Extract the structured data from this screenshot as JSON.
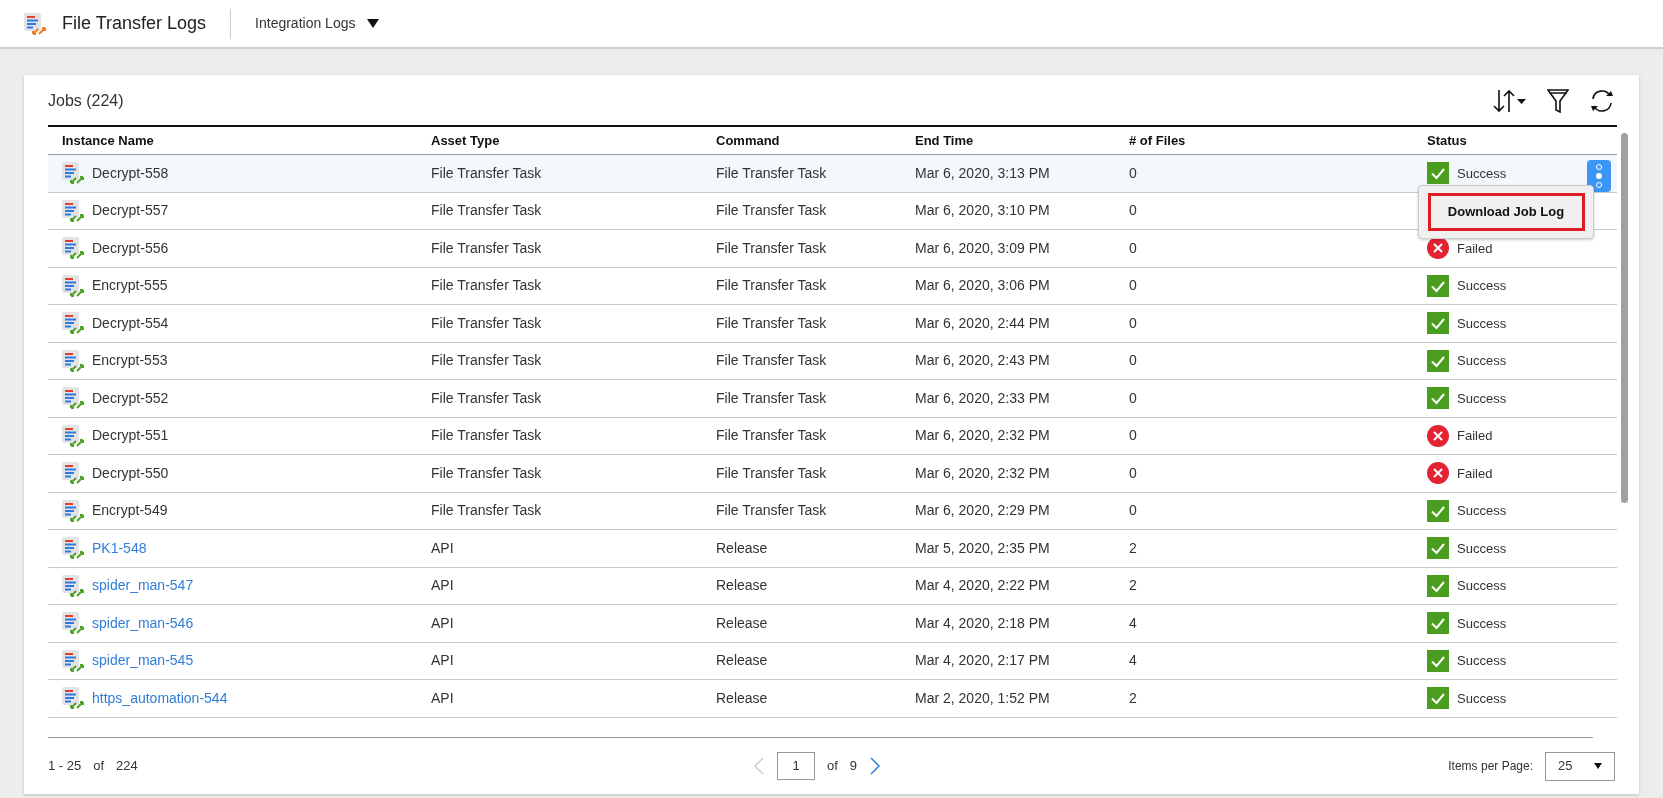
{
  "header": {
    "title": "File Transfer Logs",
    "menu": "Integration Logs"
  },
  "jobs": {
    "title": "Jobs (224)",
    "columns": [
      "Instance Name",
      "Asset Type",
      "Command",
      "End Time",
      "# of Files",
      "Status"
    ],
    "rows": [
      {
        "name": "Decrypt-558",
        "linked": false,
        "selected": true,
        "asset": "File Transfer Task",
        "command": "File Transfer Task",
        "end": "Mar 6, 2020, 3:13 PM",
        "files": "0",
        "status": {
          "kind": "success",
          "label": "Success"
        }
      },
      {
        "name": "Decrypt-557",
        "linked": false,
        "selected": false,
        "asset": "File Transfer Task",
        "command": "File Transfer Task",
        "end": "Mar 6, 2020, 3:10 PM",
        "files": "0"
      },
      {
        "name": "Decrypt-556",
        "linked": false,
        "selected": false,
        "asset": "File Transfer Task",
        "command": "File Transfer Task",
        "end": "Mar 6, 2020, 3:09 PM",
        "files": "0",
        "status": {
          "kind": "failed",
          "label": "Failed"
        }
      },
      {
        "name": "Encrypt-555",
        "linked": false,
        "selected": false,
        "asset": "File Transfer Task",
        "command": "File Transfer Task",
        "end": "Mar 6, 2020, 3:06 PM",
        "files": "0",
        "status": {
          "kind": "success",
          "label": "Success"
        }
      },
      {
        "name": "Decrypt-554",
        "linked": false,
        "selected": false,
        "asset": "File Transfer Task",
        "command": "File Transfer Task",
        "end": "Mar 6, 2020, 2:44 PM",
        "files": "0",
        "status": {
          "kind": "success",
          "label": "Success"
        }
      },
      {
        "name": "Encrypt-553",
        "linked": false,
        "selected": false,
        "asset": "File Transfer Task",
        "command": "File Transfer Task",
        "end": "Mar 6, 2020, 2:43 PM",
        "files": "0",
        "status": {
          "kind": "success",
          "label": "Success"
        }
      },
      {
        "name": "Decrypt-552",
        "linked": false,
        "selected": false,
        "asset": "File Transfer Task",
        "command": "File Transfer Task",
        "end": "Mar 6, 2020, 2:33 PM",
        "files": "0",
        "status": {
          "kind": "success",
          "label": "Success"
        }
      },
      {
        "name": "Decrypt-551",
        "linked": false,
        "selected": false,
        "asset": "File Transfer Task",
        "command": "File Transfer Task",
        "end": "Mar 6, 2020, 2:32 PM",
        "files": "0",
        "status": {
          "kind": "failed",
          "label": "Failed"
        }
      },
      {
        "name": "Decrypt-550",
        "linked": false,
        "selected": false,
        "asset": "File Transfer Task",
        "command": "File Transfer Task",
        "end": "Mar 6, 2020, 2:32 PM",
        "files": "0",
        "status": {
          "kind": "failed",
          "label": "Failed"
        }
      },
      {
        "name": "Encrypt-549",
        "linked": false,
        "selected": false,
        "asset": "File Transfer Task",
        "command": "File Transfer Task",
        "end": "Mar 6, 2020, 2:29 PM",
        "files": "0",
        "status": {
          "kind": "success",
          "label": "Success"
        }
      },
      {
        "name": "PK1-548",
        "linked": true,
        "selected": false,
        "asset": "API",
        "command": "Release",
        "end": "Mar 5, 2020, 2:35 PM",
        "files": "2",
        "status": {
          "kind": "success",
          "label": "Success"
        }
      },
      {
        "name": "spider_man-547",
        "linked": true,
        "selected": false,
        "asset": "API",
        "command": "Release",
        "end": "Mar 4, 2020, 2:22 PM",
        "files": "2",
        "status": {
          "kind": "success",
          "label": "Success"
        }
      },
      {
        "name": "spider_man-546",
        "linked": true,
        "selected": false,
        "asset": "API",
        "command": "Release",
        "end": "Mar 4, 2020, 2:18 PM",
        "files": "4",
        "status": {
          "kind": "success",
          "label": "Success"
        }
      },
      {
        "name": "spider_man-545",
        "linked": true,
        "selected": false,
        "asset": "API",
        "command": "Release",
        "end": "Mar 4, 2020, 2:17 PM",
        "files": "4",
        "status": {
          "kind": "success",
          "label": "Success"
        }
      },
      {
        "name": "https_automation-544",
        "linked": true,
        "selected": false,
        "asset": "API",
        "command": "Release",
        "end": "Mar 2, 2020, 1:52 PM",
        "files": "2",
        "status": {
          "kind": "success",
          "label": "Success"
        }
      }
    ],
    "context_menu": {
      "item": "Download Job Log"
    }
  },
  "footer": {
    "range": "1 - 25",
    "of": "of",
    "total": "224",
    "page": "1",
    "pages_of": "of",
    "pages": "9",
    "per_page_label": "Items per Page:",
    "per_page": "25"
  }
}
